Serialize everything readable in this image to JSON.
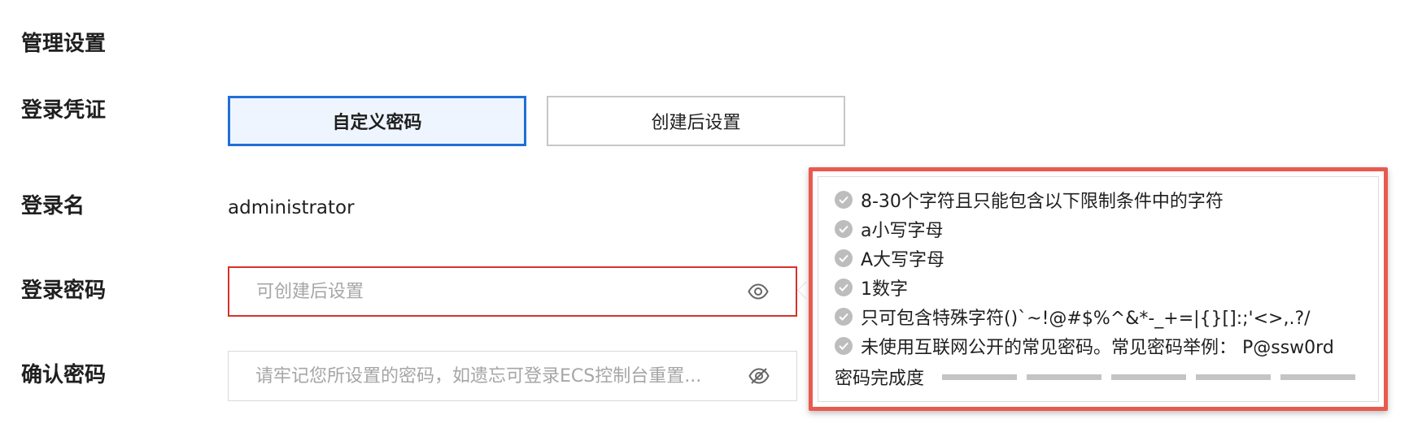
{
  "section": {
    "title": "管理设置"
  },
  "login_credential": {
    "label": "登录凭证",
    "options": [
      {
        "label": "自定义密码",
        "selected": true
      },
      {
        "label": "创建后设置",
        "selected": false
      }
    ]
  },
  "login_name": {
    "label": "登录名",
    "value": "administrator"
  },
  "login_password": {
    "label": "登录密码",
    "value": "",
    "placeholder": "可创建后设置",
    "toggle_icon": "eye-icon",
    "state": "error"
  },
  "confirm_password": {
    "label": "确认密码",
    "value": "",
    "placeholder": "请牢记您所设置的密码，如遗忘可登录ECS控制台重置...",
    "toggle_icon": "eye-off-icon"
  },
  "password_rules": {
    "items": [
      {
        "text": "8-30个字符且只能包含以下限制条件中的字符",
        "met": false
      },
      {
        "text": "a小写字母",
        "met": false
      },
      {
        "text": "A大写字母",
        "met": false
      },
      {
        "text": "1数字",
        "met": false
      },
      {
        "text": "只可包含特殊字符()`~!@#$%^&*-_+=|{}[]:;'<>,.?/",
        "met": false
      },
      {
        "text": "未使用互联网公开的常见密码。常见密码举例：  P@ssw0rd",
        "met": false
      }
    ],
    "strength_label": "密码完成度",
    "strength_level": 0,
    "strength_segments": 5
  },
  "colors": {
    "accent": "#1f6fd8",
    "error": "#d8302a",
    "highlight_frame": "#e85a4f",
    "rule_check": "#bdbdbd"
  }
}
